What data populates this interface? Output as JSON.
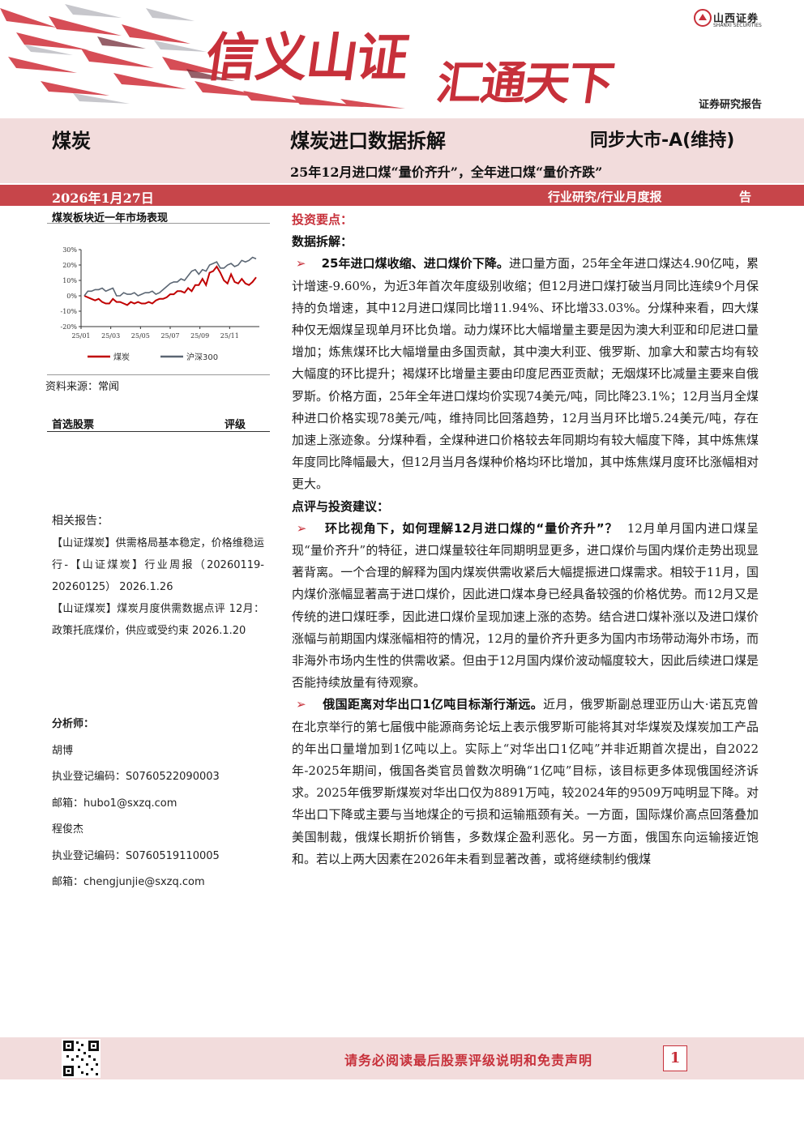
{
  "header": {
    "logo_cn": "山西证券",
    "logo_en": "SHANXI SECURITIES",
    "slogan_part1": "信义山证",
    "slogan_part2": "汇通天下",
    "report_type": "证券研究报告",
    "sector": "煤炭",
    "title": "煤炭进口数据拆解",
    "rating": "同步大市-A(维持)",
    "subtitle": "25年12月进口煤“量价齐升”，全年进口煤“量价齐跌”",
    "date": "2026年1月27日",
    "category": "行业研究/行业月度报",
    "category_tail": "告",
    "brand_color": "#c7303a"
  },
  "sidebar": {
    "chart_title": "煤炭板块近一年市场表现",
    "chart_source": "资料来源：常闻",
    "stock_label": "首选股票",
    "stock_rating_label": "评级",
    "related_heading": "相关报告：",
    "related_reports": [
      "【山证煤炭】供需格局基本稳定，价格维稳运行-【山证煤炭】行业周报（20260119-20260125） 2026.1.26",
      "【山证煤炭】煤炭月度供需数据点评 12月：政策托底煤价，供应或受约束 2026.1.20"
    ],
    "analysts_heading": "分析师：",
    "analysts": [
      {
        "name": "胡博",
        "reg": "执业登记编码：S0760522090003",
        "email": "邮箱：hubo1@sxzq.com"
      },
      {
        "name": "程俊杰",
        "reg": "执业登记编码：S0760519110005",
        "email": "邮箱：chengjunjie@sxzq.com"
      }
    ]
  },
  "chart_data": {
    "type": "line",
    "title": "",
    "x_ticks": [
      "25/01",
      "25/03",
      "25/05",
      "25/07",
      "25/09",
      "25/11"
    ],
    "y_ticks": [
      "30%",
      "20%",
      "10%",
      "0%",
      "-10%",
      "-20%"
    ],
    "ylim": [
      -20,
      30
    ],
    "legend_position": "bottom",
    "series": [
      {
        "name": "煤炭",
        "color": "#c00000",
        "values": [
          0,
          -1,
          -2,
          -3,
          -2,
          -4,
          -5,
          -5,
          -2,
          -4,
          -4,
          -5,
          -6,
          -4,
          -5,
          -4,
          -5,
          -5,
          -4,
          -5,
          -3,
          -2,
          -2,
          -1,
          1,
          1,
          3,
          3,
          2,
          5,
          3,
          7,
          7,
          11,
          7,
          15,
          16,
          19,
          15,
          10,
          8,
          14,
          9,
          8,
          11,
          8,
          7,
          9,
          12
        ]
      },
      {
        "name": "沪深300",
        "color": "#5b6673",
        "values": [
          0,
          3,
          3,
          4,
          4,
          5,
          3,
          4,
          5,
          0,
          0,
          2,
          1,
          1,
          2,
          0,
          1,
          2,
          2,
          3,
          1,
          2,
          4,
          6,
          8,
          9,
          9,
          11,
          10,
          13,
          16,
          17,
          14,
          17,
          16,
          20,
          21,
          22,
          18,
          18,
          20,
          21,
          19,
          20,
          23,
          22,
          23,
          25,
          24
        ]
      }
    ]
  },
  "body": {
    "heading_key_points": "投资要点：",
    "heading_data": "数据拆解：",
    "bullet_glyph": "➢",
    "para1_lead": "25年进口煤收缩、进口煤价下降。",
    "para1_text": "进口量方面，25年全年进口煤达4.90亿吨，累计增速-9.60%，为近3年首次年度级别收缩；但12月进口煤打破当月同比连续9个月保持的负增速，其中12月进口煤同比增11.94%、环比增33.03%。分煤种来看，四大煤种仅无烟煤呈现单月环比负增。动力煤环比大幅增量主要是因为澳大利亚和印尼进口量增加；炼焦煤环比大幅增量由多国贡献，其中澳大利亚、俄罗斯、加拿大和蒙古均有较大幅度的环比提升；褐煤环比增量主要由印度尼西亚贡献；无烟煤环比减量主要来自俄罗斯。价格方面，25年全年进口煤均价实现74美元/吨，同比降23.1%；12月当月全煤种进口价格实现78美元/吨，维持同比回落趋势，12月当月环比增5.24美元/吨，存在加速上涨迹象。分煤种看，全煤种进口价格较去年同期均有较大幅度下降，其中炼焦煤年度同比降幅最大，但12月当月各煤种价格均环比增加，其中炼焦煤月度环比涨幅相对更大。",
    "heading_advice": "点评与投资建议：",
    "para2_lead": "环比视角下，如何理解12月进口煤的“量价齐升”？",
    "para2_text": "12月单月国内进口煤呈现“量价齐升”的特征，进口煤量较往年同期明显更多，进口煤价与国内煤价走势出现显著背离。一个合理的解释为国内煤炭供需收紧后大幅提振进口煤需求。相较于11月，国内煤价涨幅显著高于进口煤价，因此进口煤本身已经具备较强的价格优势。而12月又是传统的进口煤旺季，因此进口煤价呈现加速上涨的态势。结合进口煤补涨以及进口煤价涨幅与前期国内煤涨幅相符的情况，12月的量价齐升更多为国内市场带动海外市场，而非海外市场内生性的供需收紧。但由于12月国内煤价波动幅度较大，因此后续进口煤是否能持续放量有待观察。",
    "para3_lead": "俄国距离对华出口1亿吨目标渐行渐远。",
    "para3_text": "近月，俄罗斯副总理亚历山大·诺瓦克曾在北京举行的第七届俄中能源商务论坛上表示俄罗斯可能将其对华煤炭及煤炭加工产品的年出口量增加到1亿吨以上。实际上“对华出口1亿吨”并非近期首次提出，自2022年-2025年期间，俄国各类官员曾数次明确“1亿吨”目标，该目标更多体现俄国经济诉求。2025年俄罗斯煤炭对华出口仅为8891万吨，较2024年的9509万吨明显下降。对华出口下降或主要与当地煤企的亏损和运输瓶颈有关。一方面，国际煤价高点回落叠加美国制裁，俄煤长期折价销售，多数煤企盈利恶化。另一方面，俄国东向运输接近饱和。若以上两大因素在2026年未看到显著改善，或将继续制约俄煤"
  },
  "footer": {
    "disclaimer": "请务必阅读最后股票评级说明和免责声明",
    "page_number": "1"
  }
}
